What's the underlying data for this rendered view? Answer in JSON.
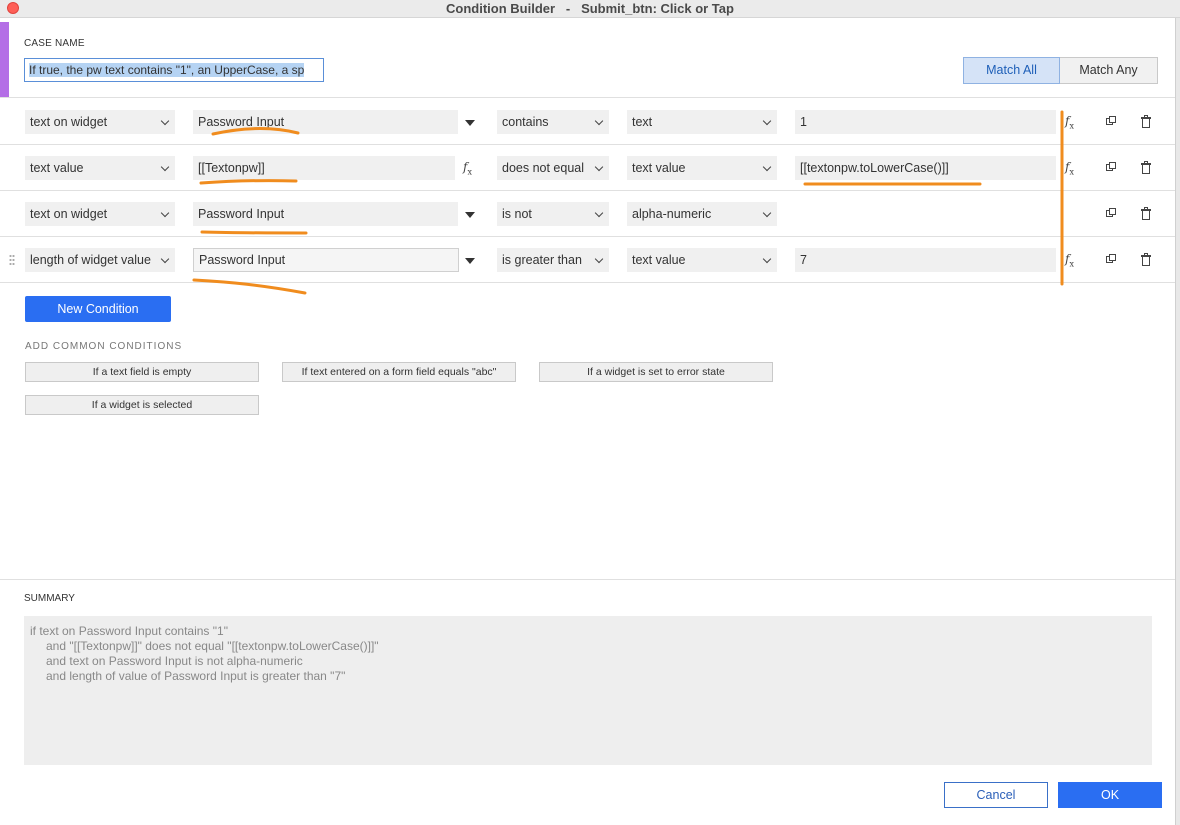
{
  "window": {
    "title": "Condition Builder   -   Submit_btn: Click or Tap"
  },
  "case": {
    "label": "CASE NAME",
    "value": "If true, the pw text contains \"1\", an UpperCase, a sp",
    "match_all": "Match All",
    "match_any": "Match Any",
    "match_selected": "Match All"
  },
  "conditions": [
    {
      "op1": "text on widget",
      "target": "Password Input",
      "comparator": "contains",
      "kind": "text",
      "value": "1"
    },
    {
      "op1": "text value",
      "target": "[[Textonpw]]",
      "comparator": "does not equal",
      "kind": "text value",
      "value": "[[textonpw.toLowerCase()]]"
    },
    {
      "op1": "text on widget",
      "target": "Password Input",
      "comparator": "is not",
      "kind": "alpha-numeric",
      "value": ""
    },
    {
      "op1": "length of widget value",
      "target": "Password Input",
      "comparator": "is greater than",
      "kind": "text value",
      "value": "7"
    }
  ],
  "actions": {
    "new_condition": "New Condition"
  },
  "common": {
    "label": "ADD COMMON CONDITIONS",
    "items": [
      "If a text field is empty",
      "If text entered on a form field equals \"abc\"",
      "If a widget is set to error state",
      "If a widget is selected"
    ]
  },
  "summary": {
    "label": "SUMMARY",
    "lines": [
      "if text on Password Input contains \"1\"",
      "and \"[[Textonpw]]\" does not equal \"[[textonpw.toLowerCase()]]\"",
      "and text on Password Input is not alpha-numeric",
      "and length of value of Password Input is greater than \"7\""
    ]
  },
  "footer": {
    "cancel": "Cancel",
    "ok": "OK"
  },
  "colors": {
    "primary_button": "#2a6ef2",
    "case_accent": "#b46ee6",
    "annotation": "#f08c1e",
    "close_button": "#fe5f57"
  },
  "icons": [
    "close-dot-icon",
    "chevron-down-icon",
    "dropdown-triangle-icon",
    "fx-icon",
    "duplicate-icon",
    "trash-icon",
    "drag-handle-icon"
  ]
}
